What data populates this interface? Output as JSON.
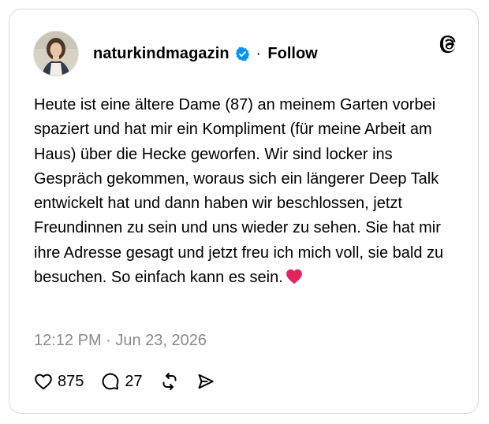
{
  "post": {
    "username": "naturkindmagazin",
    "verified": true,
    "separator": "·",
    "follow_label": "Follow",
    "text": "Heute ist eine ältere Dame (87) an meinem Garten vorbei spaziert und hat mir ein Kompliment (für meine Arbeit am Haus) über die Hecke geworfen. Wir sind locker ins Gespräch gekommen, woraus sich ein längerer Deep Talk entwickelt hat und dann haben wir beschlossen, jetzt Freundinnen zu sein und uns wieder zu sehen. Sie hat mir ihre Adresse gesagt und jetzt freu ich mich voll, sie bald zu besuchen. So einfach kann es sein.",
    "emoji": "red-heart-emoji",
    "timestamp": "12:12 PM · Jun 23, 2026",
    "likes": "875",
    "replies": "27"
  },
  "icons": {
    "brand": "threads-logo-icon",
    "verified": "verified-badge-icon",
    "like": "heart-outline-icon",
    "reply": "comment-bubble-icon",
    "repost": "repost-icon",
    "share": "share-send-icon"
  },
  "colors": {
    "verified_blue": "#0095f6",
    "timestamp_gray": "#8a8a8a",
    "heart_red": "#e0245e",
    "border": "#d9d9d9"
  }
}
